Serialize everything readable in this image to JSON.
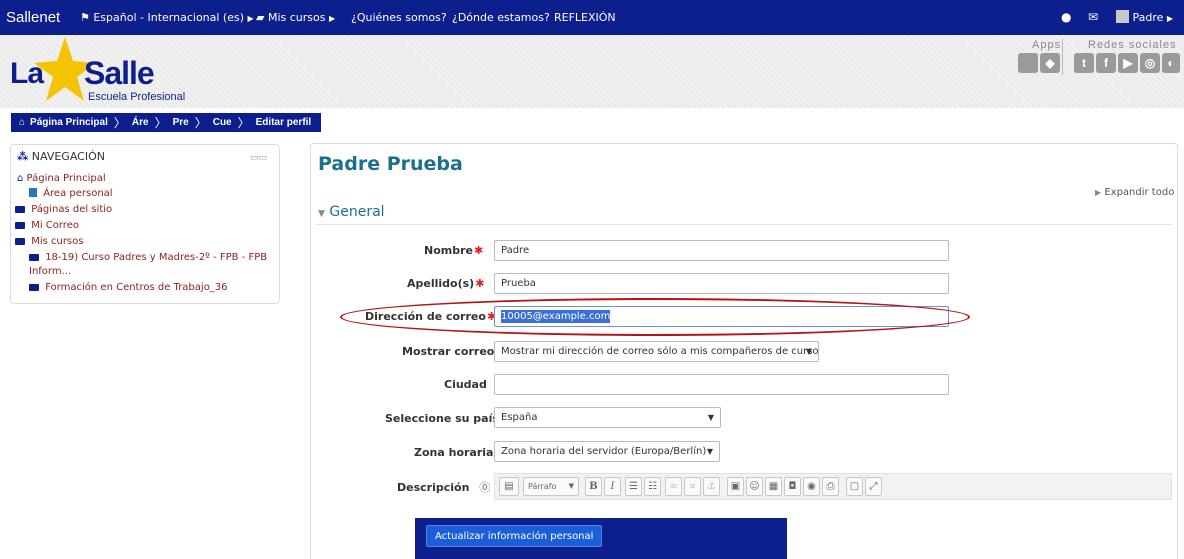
{
  "navbar": {
    "brand": "Sallenet",
    "language": "Español - Internacional (es)",
    "courses": "Mis cursos",
    "about": "¿Quiénes somos?",
    "where": "¿Dónde estamos?",
    "reflection": "REFLEXIÓN",
    "user": "Padre",
    "bg_color": "#0c1f8c"
  },
  "header": {
    "logo_la": "La",
    "logo_salle": "Salle",
    "logo_subtitle": "Escuela Profesional",
    "apps_label": "Apps",
    "social_label": "Redes sociales"
  },
  "breadcrumb": {
    "items": [
      "Página Principal",
      "Áre",
      "Pre",
      "Cue",
      "Editar perfil"
    ]
  },
  "nav_block": {
    "title": "NAVEGACIÓN",
    "items": [
      "Página Principal",
      "Área personal",
      "Páginas del sitio",
      "Mi Correo",
      "Mis cursos",
      "18-19) Curso Padres y Madres-2º - FPB - FPB",
      "Inform...",
      "Formación en Centros de Trabajo_36"
    ]
  },
  "main": {
    "title": "Padre Prueba",
    "expand_all": "Expandir todo",
    "section": "General"
  },
  "form": {
    "nombre_label": "Nombre",
    "nombre_value": "Padre",
    "apellido_label": "Apellido(s)",
    "apellido_value": "Prueba",
    "correo_label": "Dirección de correo",
    "correo_value": "10005@example.com",
    "mostrar_label": "Mostrar correo",
    "mostrar_value": "Mostrar mi dirección de correo sólo a mis compañeros de curso",
    "ciudad_label": "Ciudad",
    "ciudad_value": "",
    "pais_label": "Seleccione su país",
    "pais_value": "España",
    "zona_label": "Zona horaria",
    "zona_value": "Zona horaria del servidor (Europa/Berlín)",
    "descripcion_label": "Descripción",
    "editor_format": "Párrafo",
    "submit_label": "Actualizar información personal"
  },
  "colors": {
    "accent": "#0c1f8c",
    "title": "#1b6f8f",
    "link": "#8b1f1f",
    "required": "#e02020",
    "highlight_ellipse": "#b41414"
  }
}
